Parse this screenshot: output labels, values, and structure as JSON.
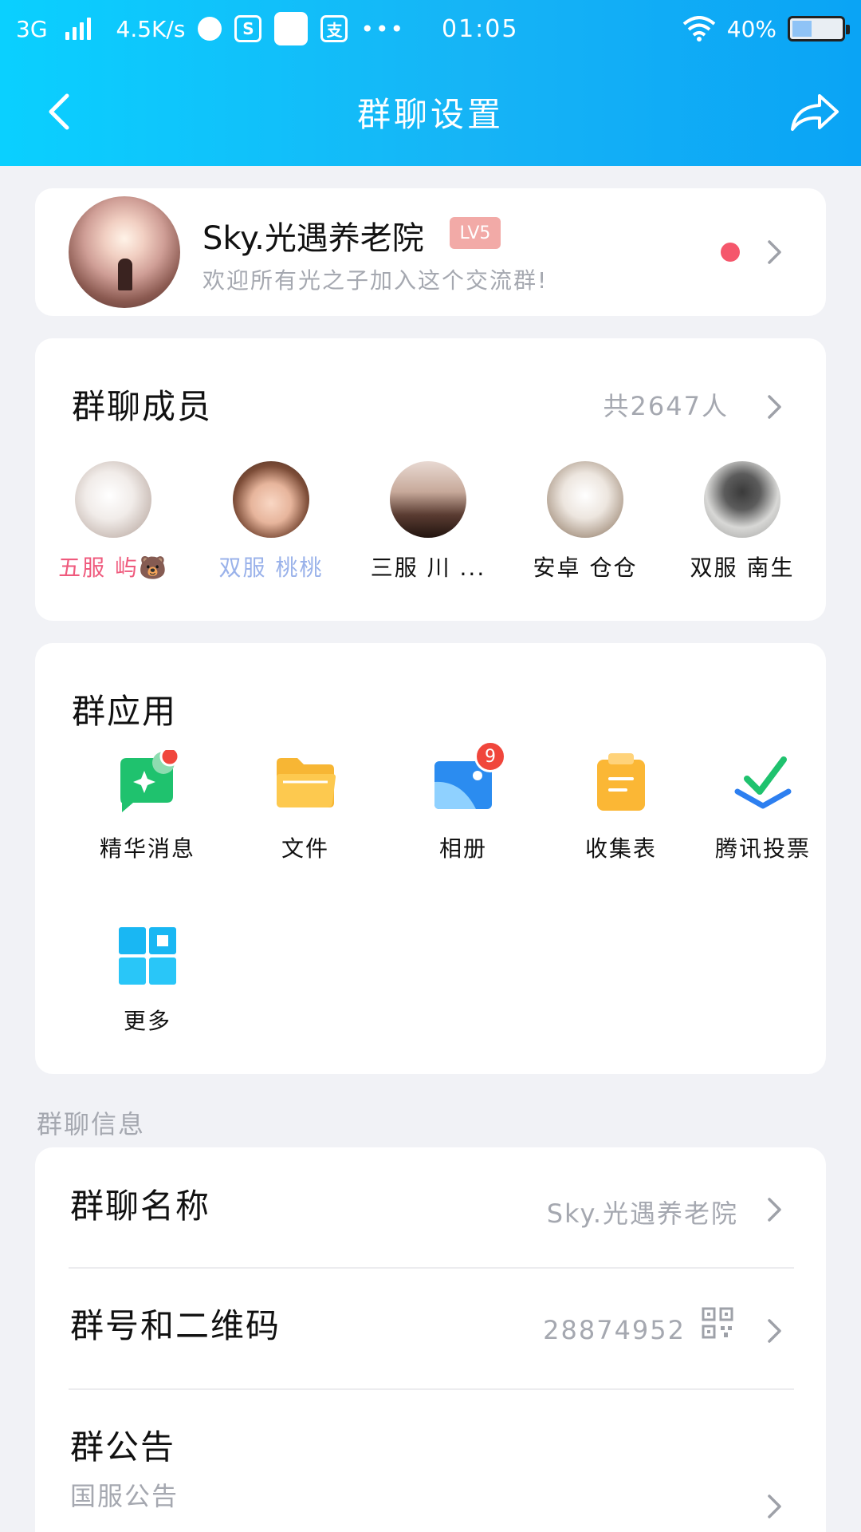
{
  "status_bar": {
    "network": "3G",
    "speed": "4.5K/s",
    "time": "01:05",
    "battery": "40%",
    "battery_level": 0.4
  },
  "header": {
    "title": "群聊设置",
    "background": "#16b4f6"
  },
  "group": {
    "name": "Sky.光遇养老院",
    "level": "LV5",
    "intro": "欢迎所有光之子加入这个交流群!"
  },
  "members": {
    "title": "群聊成员",
    "count": "共2647人",
    "list": [
      {
        "name": "五服 屿🐻",
        "color": "#ef5a7d"
      },
      {
        "name": "双服 桃桃",
        "color": "#9ab2ea"
      },
      {
        "name": "三服 川 ...",
        "color": "#111111"
      },
      {
        "name": "安卓 仓仓",
        "color": "#111111"
      },
      {
        "name": "双服 南生",
        "color": "#111111"
      }
    ]
  },
  "apps": {
    "title": "群应用",
    "items": [
      {
        "label": "精华消息",
        "icon": "essence-message-icon"
      },
      {
        "label": "文件",
        "icon": "folder-icon"
      },
      {
        "label": "相册",
        "icon": "album-icon",
        "badge": "9"
      },
      {
        "label": "收集表",
        "icon": "clipboard-icon"
      },
      {
        "label": "腾讯投票",
        "icon": "vote-check-icon"
      },
      {
        "label": "更多",
        "icon": "more-grid-icon"
      }
    ]
  },
  "info": {
    "section_label": "群聊信息",
    "name_row": {
      "label": "群聊名称",
      "value": "Sky.光遇养老院"
    },
    "number_row": {
      "label": "群号和二维码",
      "value": "28874952"
    },
    "notice_row": {
      "label": "群公告",
      "value": "国服公告"
    }
  }
}
